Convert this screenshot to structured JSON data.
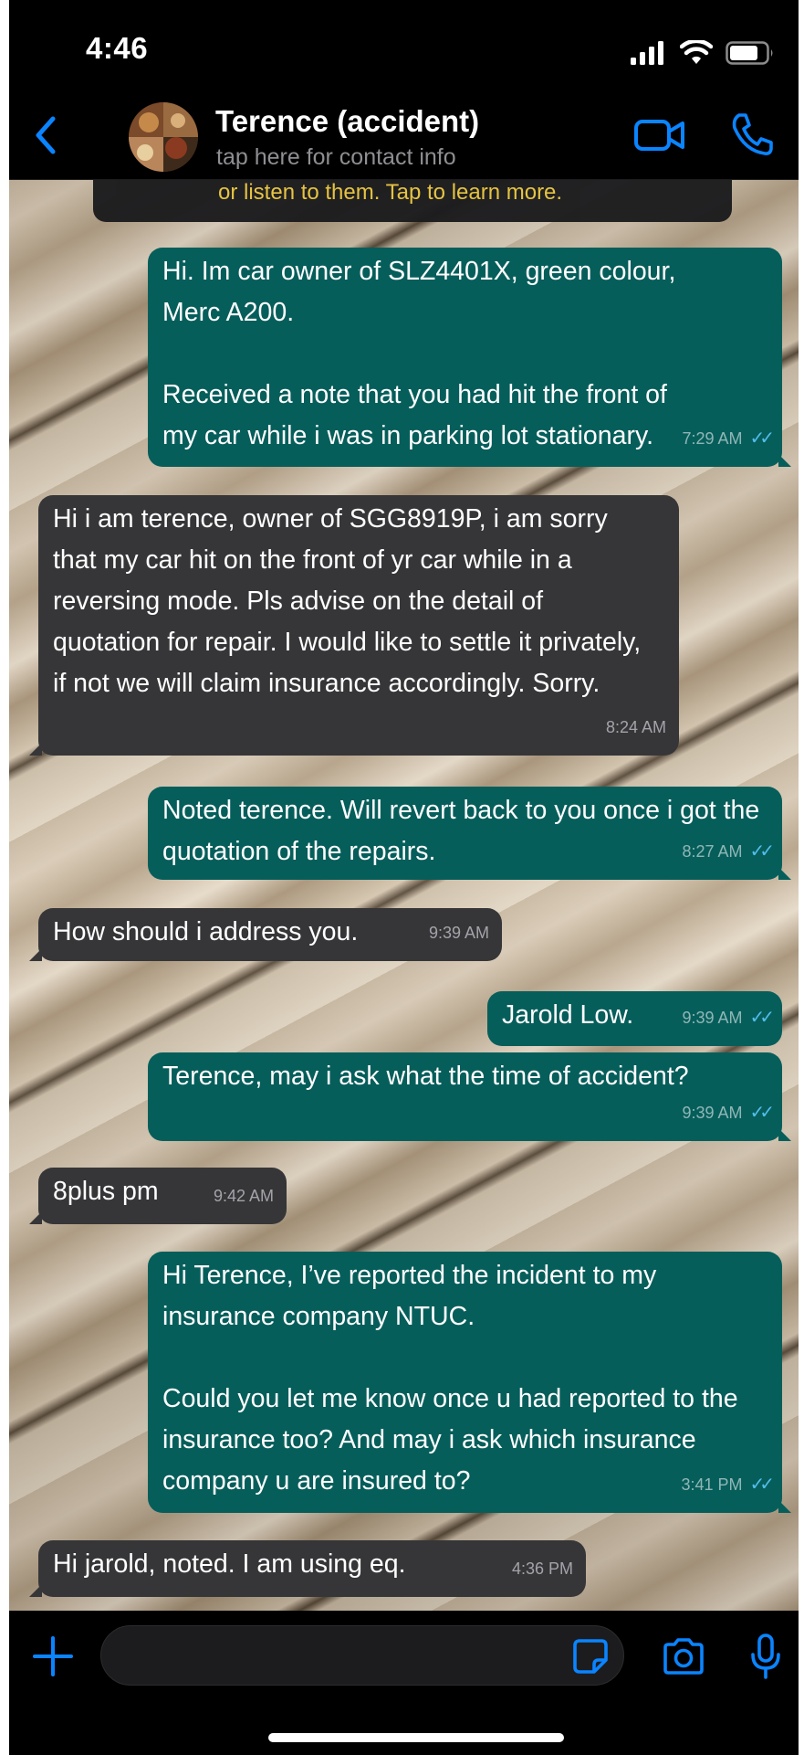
{
  "status_bar": {
    "time": "4:46"
  },
  "header": {
    "contact_name": "Terence (accident)",
    "contact_subtitle": "tap here for contact info"
  },
  "banner": {
    "text": "or listen to them. Tap to learn more."
  },
  "messages": [
    {
      "direction": "out",
      "text": "Hi. Im car owner of SLZ4401X, green colour, Merc A200.\n\nReceived a note that you had hit the front of my car while i was in parking lot stationary.",
      "time": "7:29 AM",
      "read": true
    },
    {
      "direction": "in",
      "text": "Hi i am terence, owner of SGG8919P, i am sorry that my car hit on the front of yr car while in a reversing mode. Pls advise on the detail of quotation for repair. I would like to settle it privately, if not we will claim insurance accordingly. Sorry.",
      "time": "8:24 AM"
    },
    {
      "direction": "out",
      "text": "Noted terence. Will revert back to you once i got the quotation of the repairs.",
      "time": "8:27 AM",
      "read": true
    },
    {
      "direction": "in",
      "text": "How should i address you.",
      "time": "9:39 AM"
    },
    {
      "direction": "out",
      "text": "Jarold Low.",
      "time": "9:39 AM",
      "read": true
    },
    {
      "direction": "out",
      "text": "Terence, may i ask what the time of accident?",
      "time": "9:39 AM",
      "read": true
    },
    {
      "direction": "in",
      "text": "8plus pm",
      "time": "9:42 AM"
    },
    {
      "direction": "out",
      "text": "Hi Terence, I’ve reported the incident to my insurance company NTUC.\n\nCould you let me know once u had reported to the insurance too? And may i ask which insurance company u are insured to?",
      "time": "3:41 PM",
      "read": true
    },
    {
      "direction": "in",
      "text": "Hi jarold, noted. I am using eq.",
      "time": "4:36 PM"
    }
  ],
  "input": {
    "placeholder": "",
    "value": ""
  },
  "colors": {
    "accent": "#0a84ff",
    "outgoing_bubble": "#065e5b",
    "incoming_bubble": "#363638",
    "read_ticks": "#53bdeb",
    "banner_text": "#e8c540"
  },
  "icons": {
    "back": "chevron-left-icon",
    "video": "video-camera-icon",
    "call": "phone-icon",
    "plus": "plus-icon",
    "sticker": "sticker-icon",
    "camera": "camera-icon",
    "mic": "microphone-icon"
  }
}
